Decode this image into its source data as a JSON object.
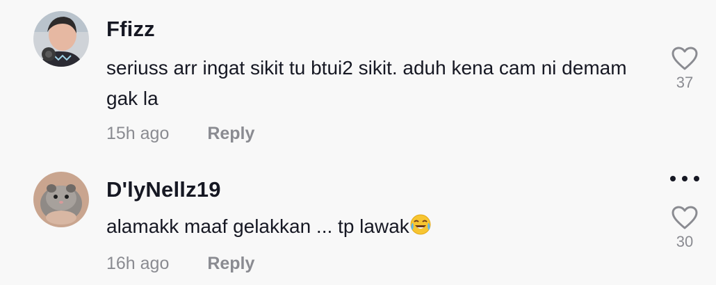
{
  "comments": [
    {
      "username": "Ffizz",
      "text": "seriuss arr ingat sikit tu btui2 sikit. aduh kena cam ni demam gak la",
      "time": "15h ago",
      "reply_label": "Reply",
      "likes": "37",
      "avatar_icon": "user-photo-avatar"
    },
    {
      "username": "D'lyNellz19",
      "text": "alamakk maaf gelakkan ... tp lawak",
      "emoji": "face-with-tears-of-joy-icon",
      "time": "16h ago",
      "reply_label": "Reply",
      "likes": "30",
      "avatar_icon": "hamster-photo-avatar"
    }
  ],
  "more_icon": "more-options-icon",
  "colors": {
    "background": "#f8f8f8",
    "text": "#161823",
    "muted": "#8a8b91"
  }
}
